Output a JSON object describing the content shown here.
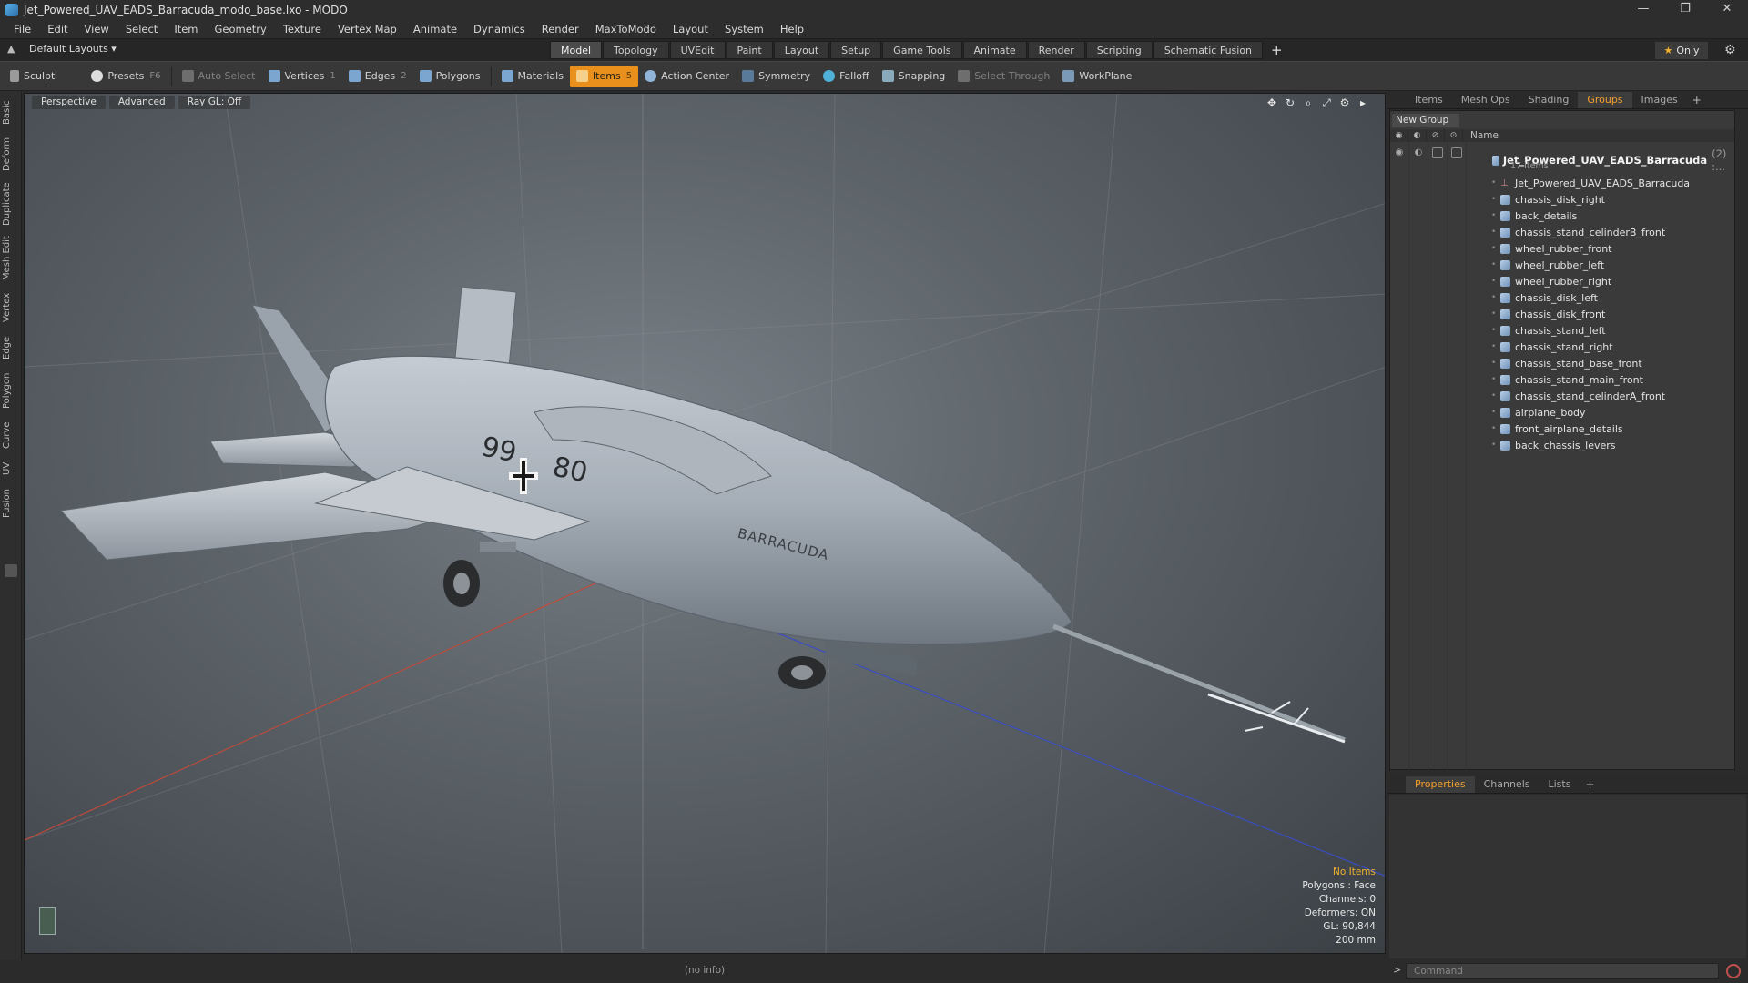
{
  "window": {
    "title": "Jet_Powered_UAV_EADS_Barracuda_modo_base.lxo - MODO",
    "controls": [
      "—",
      "❐",
      "✕"
    ]
  },
  "menu": [
    "File",
    "Edit",
    "View",
    "Select",
    "Item",
    "Geometry",
    "Texture",
    "Vertex Map",
    "Animate",
    "Dynamics",
    "Render",
    "MaxToModo",
    "Layout",
    "System",
    "Help"
  ],
  "layoutbar": {
    "layout_selector": "Default Layouts ▾",
    "tabs": [
      "Model",
      "Topology",
      "UVEdit",
      "Paint",
      "Layout",
      "Setup",
      "Game Tools",
      "Animate",
      "Render",
      "Scripting",
      "Schematic Fusion"
    ],
    "active_tab": "Model",
    "add_label": "+",
    "only_label": "Only"
  },
  "toolbar": {
    "sculpt": "Sculpt",
    "presets": "Presets",
    "presets_key": "F6",
    "auto_select": "Auto Select",
    "vertices": "Vertices",
    "vertices_count": "1",
    "edges": "Edges",
    "edges_count": "2",
    "polygons": "Polygons",
    "materials": "Materials",
    "items": "Items",
    "items_count": "5",
    "action_center": "Action Center",
    "symmetry": "Symmetry",
    "falloff": "Falloff",
    "snapping": "Snapping",
    "select_through": "Select Through",
    "workplane": "WorkPlane"
  },
  "left_tabs": [
    "Basic",
    "Deform",
    "Duplicate",
    "Mesh Edit",
    "Vertex",
    "Edge",
    "Polygon",
    "Curve",
    "UV",
    "Fusion"
  ],
  "viewport": {
    "view_mode": "Perspective",
    "shading": "Advanced",
    "raygl": "Ray GL: Off",
    "model_markings": {
      "left_number": "99",
      "right_number": "80",
      "brand": "BARRACUDA"
    },
    "info": {
      "no_items": "No Items",
      "polygons": "Polygons : Face",
      "channels": "Channels: 0",
      "deformers": "Deformers: ON",
      "gl": "GL: 90,844",
      "scale": "200 mm"
    }
  },
  "status": {
    "text": "(no info)"
  },
  "right_panel": {
    "tabs": [
      "Items",
      "Mesh Ops",
      "Shading",
      "Groups",
      "Images"
    ],
    "active_tab": "Groups",
    "new_group": "New Group",
    "column_name": "Name",
    "root": {
      "name": "Jet_Powered_UAV_EADS_Barracuda",
      "count": "(2) :...",
      "sub": "17 Items"
    },
    "items": [
      "Jet_Powered_UAV_EADS_Barracuda",
      "chassis_disk_right",
      "back_details",
      "chassis_stand_celinderB_front",
      "wheel_rubber_front",
      "wheel_rubber_left",
      "wheel_rubber_right",
      "chassis_disk_left",
      "chassis_disk_front",
      "chassis_stand_left",
      "chassis_stand_right",
      "chassis_stand_base_front",
      "chassis_stand_main_front",
      "chassis_stand_celinderA_front",
      "airplane_body",
      "front_airplane_details",
      "back_chassis_levers"
    ],
    "bottom_tabs": [
      "Properties",
      "Channels",
      "Lists"
    ],
    "bottom_active": "Properties"
  },
  "command": {
    "placeholder": "Command",
    "prompt": ">"
  },
  "colors": {
    "accent": "#e88f1c",
    "active_tab_text": "#f0a030"
  }
}
